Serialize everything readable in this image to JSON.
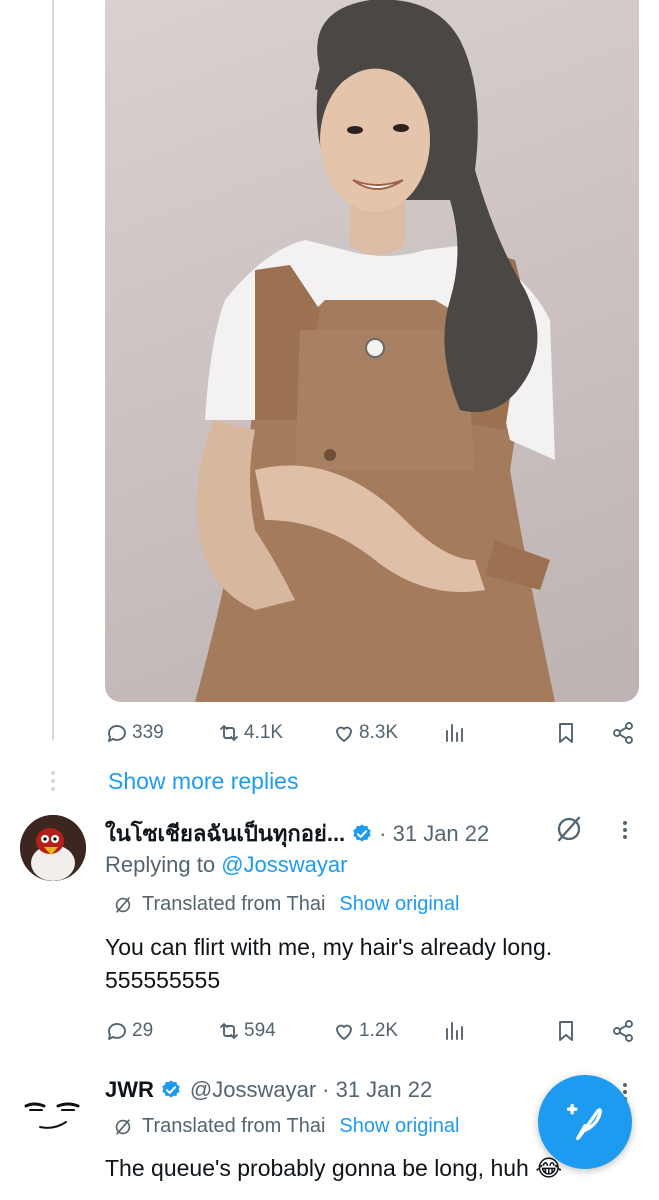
{
  "tweet_main": {
    "stats": {
      "replies": "339",
      "retweets": "4.1K",
      "likes": "8.3K"
    }
  },
  "show_more_replies": "Show more replies",
  "reply1": {
    "name": "ในโซเชียลฉันเป็นทุกอย่...",
    "date": "· 31 Jan 22",
    "replying_prefix": "Replying to ",
    "replying_handle": "@Josswayar",
    "translated_label": "Translated from Thai",
    "show_original": "Show original",
    "text_line1": "You can flirt with me, my hair's already long.",
    "text_line2": "555555555",
    "stats": {
      "replies": "29",
      "retweets": "594",
      "likes": "1.2K"
    }
  },
  "reply2": {
    "name": "JWR",
    "handle": "@Josswayar",
    "date": "· 31 Jan 22",
    "translated_label": "Translated from Thai",
    "show_original": "Show original",
    "text": "The queue's probably gonna be long, huh 😂"
  },
  "colors": {
    "accent": "#1d9bf0",
    "muted": "#536471",
    "text": "#0f1419",
    "line": "#cfd9de"
  }
}
